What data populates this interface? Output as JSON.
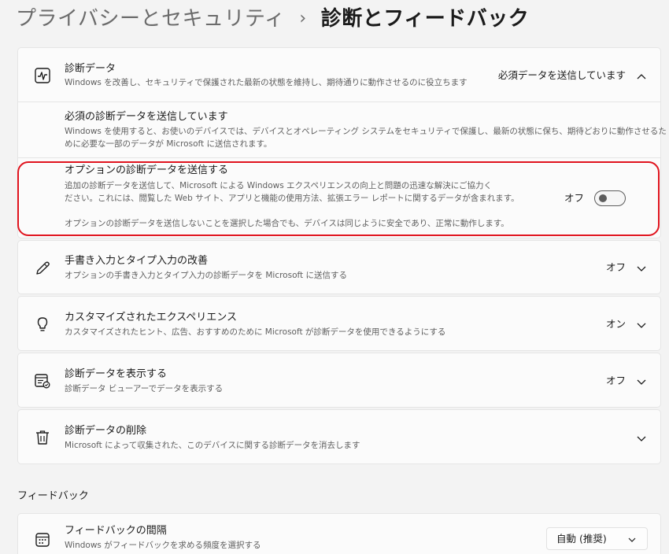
{
  "breadcrumb": {
    "parent": "プライバシーとセキュリティ",
    "separator": "›",
    "current": "診断とフィードバック"
  },
  "diagnostic_data": {
    "title": "診断データ",
    "description": "Windows を改善し、セキュリティで保護された最新の状態を維持し、期待通りに動作させるのに役立ちます",
    "status": "必須データを送信しています",
    "icon": "pulse-icon",
    "expanded": true,
    "required": {
      "title": "必須の診断データを送信しています",
      "description_line1": "Windows を使用すると、お使いのデバイスでは、デバイスとオペレーティング システムをセキュリティで保護し、最新の状態に保ち、期待どおりに動作させるた",
      "description_line2": "めに必要な一部のデータが Microsoft に送信されます。"
    },
    "optional": {
      "title": "オプションの診断データを送信する",
      "description_line1": "追加の診断データを送信して、Microsoft による Windows エクスペリエンスの向上と問題の迅速な解決にご協力く",
      "description_line2": "ださい。これには、閲覧した Web サイト、アプリと機能の使用方法、拡張エラー レポートに関するデータが含まれます。",
      "note": "オプションの診断データを送信しないことを選択した場合でも、デバイスは同じように安全であり、正常に動作します。",
      "toggle_label": "オフ",
      "toggle_on": false
    }
  },
  "handwriting": {
    "title": "手書き入力とタイプ入力の改善",
    "description": "オプションの手書き入力とタイプ入力の診断データを Microsoft に送信する",
    "status": "オフ",
    "icon": "pen-icon"
  },
  "tailored": {
    "title": "カスタマイズされたエクスペリエンス",
    "description": "カスタマイズされたヒント、広告、おすすめのために Microsoft が診断データを使用できるようにする",
    "status": "オン",
    "icon": "lightbulb-icon"
  },
  "view_data": {
    "title": "診断データを表示する",
    "description": "診断データ ビューアーでデータを表示する",
    "status": "オフ",
    "icon": "data-viewer-icon"
  },
  "delete_data": {
    "title": "診断データの削除",
    "description": "Microsoft によって収集された、このデバイスに関する診断データを消去します",
    "icon": "trash-icon"
  },
  "feedback_section": {
    "title": "フィードバック",
    "frequency": {
      "title": "フィードバックの間隔",
      "description": "Windows がフィードバックを求める頻度を選択する",
      "value": "自動 (推奨)",
      "icon": "calendar-icon"
    }
  },
  "colors": {
    "background": "#f3f3f3",
    "card": "#fbfbfb",
    "highlight": "#e0141e"
  }
}
